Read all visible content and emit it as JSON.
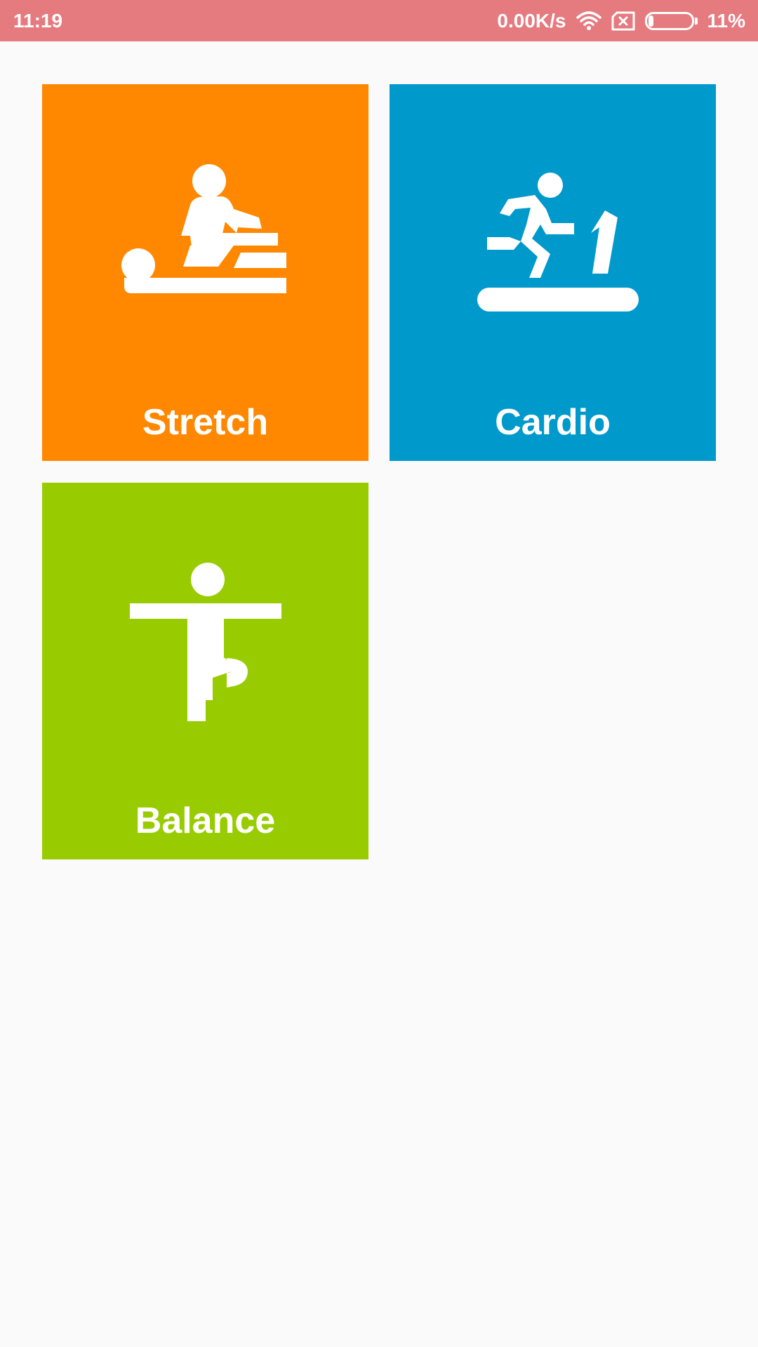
{
  "status_bar": {
    "time": "11:19",
    "network_speed": "0.00K/s",
    "battery_percent": "11%",
    "battery_level": 0.11,
    "icons": [
      "wifi-icon",
      "no-sim-icon",
      "battery-icon"
    ],
    "background_color": "#e57a7f"
  },
  "tiles": [
    {
      "label": "Stretch",
      "icon": "physiotherapy-icon",
      "color": "#ff8800"
    },
    {
      "label": "Cardio",
      "icon": "treadmill-runner-icon",
      "color": "#0099cc"
    },
    {
      "label": "Balance",
      "icon": "tree-pose-icon",
      "color": "#99cc00"
    }
  ]
}
